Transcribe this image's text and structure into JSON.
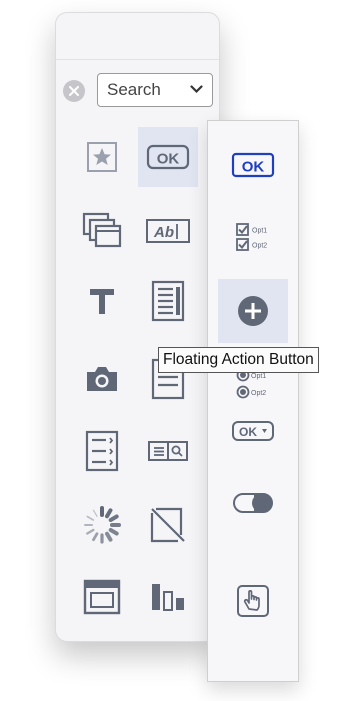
{
  "search": {
    "selected": "Search"
  },
  "palette_items": [
    {
      "name": "rating-icon"
    },
    {
      "name": "button-icon"
    },
    {
      "name": "stacked-windows-icon"
    },
    {
      "name": "text-field-icon"
    },
    {
      "name": "label-text-icon"
    },
    {
      "name": "form-list-icon"
    },
    {
      "name": "camera-icon"
    },
    {
      "name": "document-icon"
    },
    {
      "name": "checklist-icon"
    },
    {
      "name": "search-field-icon"
    },
    {
      "name": "spinner-icon"
    },
    {
      "name": "image-placeholder-icon"
    },
    {
      "name": "window-icon"
    },
    {
      "name": "bar-graph-icon"
    }
  ],
  "submenu_items": [
    {
      "name": "ok-button-icon",
      "text": "OK"
    },
    {
      "name": "checkbox-group-icon",
      "opt1": "Opt1",
      "opt2": "Opt2"
    },
    {
      "name": "floating-action-button-icon"
    },
    {
      "name": "radio-group-icon",
      "opt1": "Opt1",
      "opt2": "Opt2"
    },
    {
      "name": "dropdown-button-icon",
      "text": "OK"
    },
    {
      "name": "toggle-switch-icon"
    },
    {
      "name": "tap-gesture-icon"
    }
  ],
  "tooltip": {
    "text": "Floating Action Button"
  },
  "colors": {
    "icon": "#606878",
    "accent": "#1f3fbf",
    "selection": "#e1e5f1"
  }
}
